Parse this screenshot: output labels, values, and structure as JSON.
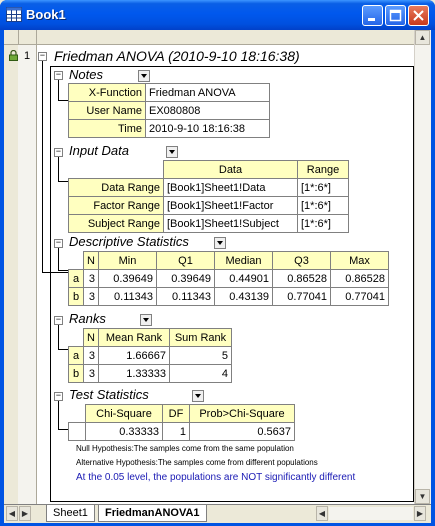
{
  "window": {
    "title": "Book1"
  },
  "row": {
    "number": "1"
  },
  "report": {
    "title": "Friedman ANOVA (2010-9-10 18:16:38)",
    "notes": {
      "title": "Notes",
      "rows": [
        {
          "label": "X-Function",
          "value": "Friedman ANOVA"
        },
        {
          "label": "User Name",
          "value": "EX080808"
        },
        {
          "label": "Time",
          "value": "2010-9-10 18:16:38"
        }
      ]
    },
    "input": {
      "title": "Input Data",
      "headers": [
        "Data",
        "Range"
      ],
      "rows": [
        {
          "label": "Data Range",
          "data": "[Book1]Sheet1!Data",
          "range": "[1*:6*]"
        },
        {
          "label": "Factor Range",
          "data": "[Book1]Sheet1!Factor",
          "range": "[1*:6*]"
        },
        {
          "label": "Subject Range",
          "data": "[Book1]Sheet1!Subject",
          "range": "[1*:6*]"
        }
      ]
    },
    "desc": {
      "title": "Descriptive Statistics",
      "headers": [
        "N",
        "Min",
        "Q1",
        "Median",
        "Q3",
        "Max"
      ],
      "rows": [
        {
          "label": "a",
          "n": "3",
          "min": "0.39649",
          "q1": "0.39649",
          "median": "0.44901",
          "q3": "0.86528",
          "max": "0.86528"
        },
        {
          "label": "b",
          "n": "3",
          "min": "0.11343",
          "q1": "0.11343",
          "median": "0.43139",
          "q3": "0.77041",
          "max": "0.77041"
        }
      ]
    },
    "ranks": {
      "title": "Ranks",
      "headers": [
        "N",
        "Mean Rank",
        "Sum Rank"
      ],
      "rows": [
        {
          "label": "a",
          "n": "3",
          "mean": "1.66667",
          "sum": "5"
        },
        {
          "label": "b",
          "n": "3",
          "mean": "1.33333",
          "sum": "4"
        }
      ]
    },
    "test": {
      "title": "Test Statistics",
      "headers": [
        "Chi-Square",
        "DF",
        "Prob>Chi-Square"
      ],
      "values": {
        "chi": "0.33333",
        "df": "1",
        "prob": "0.5637"
      },
      "null_hyp": "Null Hypothesis:The samples come from the same population",
      "alt_hyp": "Alternative Hypothesis:The samples come from different populations",
      "conclusion": "At the 0.05 level, the populations are NOT significantly different"
    }
  },
  "tabs": [
    {
      "label": "Sheet1"
    },
    {
      "label": "FriedmanANOVA1"
    }
  ],
  "colors": {
    "titlebar": "#0054e3",
    "header_fill": "#ffffc0",
    "conclusion_text": "#1a1ab4"
  }
}
